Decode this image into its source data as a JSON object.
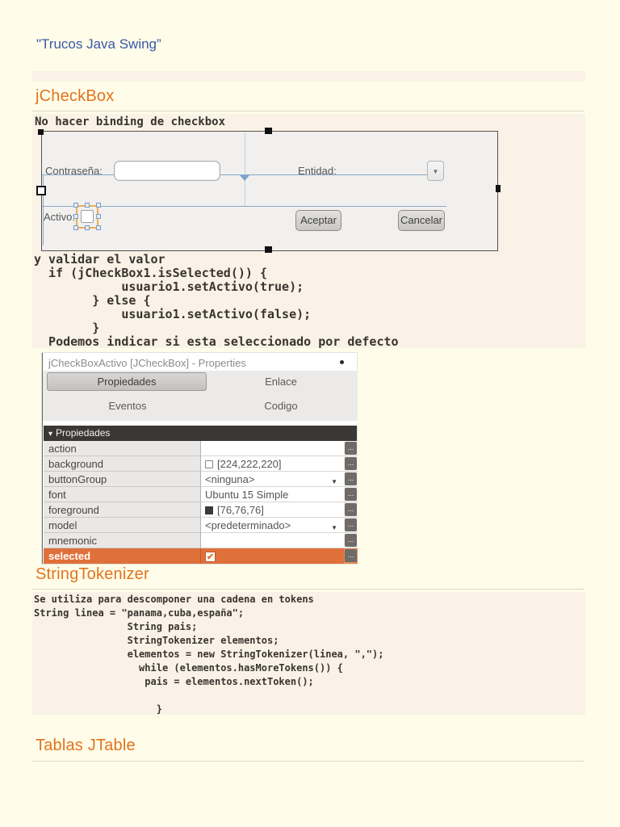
{
  "page": {
    "title": "\"Trucos Java Swing”"
  },
  "sections": {
    "jcheckbox_heading": "jCheckBox",
    "stringtokenizer_heading": "StringTokenizer",
    "tablas_heading": "Tablas JTable"
  },
  "code_blocks": {
    "binding_note": "No hacer binding de checkbox",
    "validate_lines": [
      "y validar el valor",
      "  if (jCheckBox1.isSelected()) {",
      "            usuario1.setActivo(true);",
      "        } else {",
      "            usuario1.setActivo(false);",
      "        }",
      "  Podemos indicar si esta seleccionado por defecto"
    ],
    "tokenizer_lines": [
      "Se utiliza para descomponer una cadena en tokens",
      "String linea = \"panama,cuba,españa\";",
      "                String pais;",
      "                StringTokenizer elementos;",
      "                elementos = new StringTokenizer(linea, \",\");",
      "                  while (elementos.hasMoreTokens()) {",
      "                   pais = elementos.nextToken();",
      "",
      "                     }"
    ]
  },
  "form_designer": {
    "password_label": "Contraseña:",
    "entity_label": "Entidad:",
    "active_label": "Activo:",
    "accept_button": "Aceptar",
    "cancel_button": "Cancelar"
  },
  "properties_panel": {
    "title": "jCheckBoxActivo [JCheckBox] - Properties",
    "tabs": {
      "propiedades": "Propiedades",
      "enlace": "Enlace",
      "eventos": "Eventos",
      "codigo": "Codigo"
    },
    "section_header": "Propiedades",
    "rows": [
      {
        "name": "action",
        "value": ""
      },
      {
        "name": "background",
        "value": "[224,222,220]"
      },
      {
        "name": "buttonGroup",
        "value": "<ninguna>"
      },
      {
        "name": "font",
        "value": "Ubuntu 15 Simple"
      },
      {
        "name": "foreground",
        "value": "[76,76,76]"
      },
      {
        "name": "model",
        "value": "<predeterminado>"
      },
      {
        "name": "mnemonic",
        "value": ""
      },
      {
        "name": "selected",
        "value": ""
      }
    ],
    "more_button": "..."
  },
  "icons": {
    "dropdown_arrow": "▼",
    "combo_arrow": "▼",
    "section_triangle": "▾",
    "check_mark": "✔"
  },
  "colors": {
    "page_bg": "#fffde9",
    "band_bg": "#faf2e6",
    "heading_orange": "#e2731e",
    "title_blue": "#3a57a8",
    "selected_row_orange": "#e0703a",
    "guide_blue": "#8aa8c8"
  }
}
